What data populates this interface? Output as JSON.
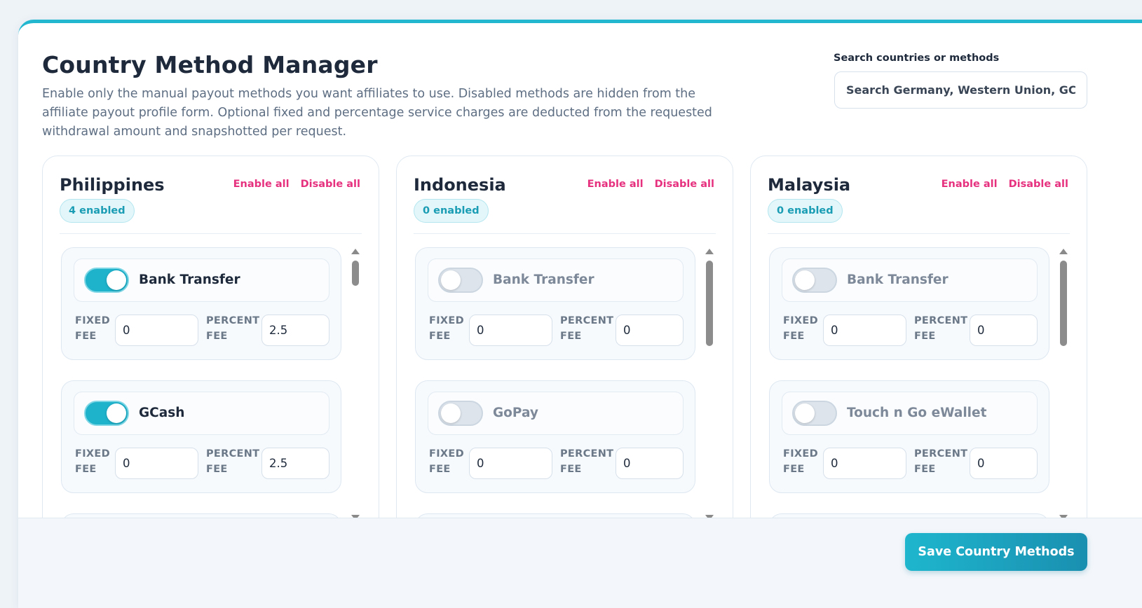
{
  "header": {
    "title": "Country Method Manager",
    "description": "Enable only the manual payout methods you want affiliates to use. Disabled methods are hidden from the affiliate payout profile form. Optional fixed and percentage service charges are deducted from the requested withdrawal amount and snapshotted per request."
  },
  "search": {
    "label": "Search countries or methods",
    "placeholder": "Search Germany, Western Union, GCash..."
  },
  "labels": {
    "enable_all": "Enable all",
    "disable_all": "Disable all",
    "fixed_fee": "FIXED\nFEE",
    "percent_fee": "PERCENT\nFEE"
  },
  "countries": [
    {
      "name": "Philippines",
      "badge": "4 enabled",
      "scroll_thumb_fraction": 0.1,
      "methods": [
        {
          "name": "Bank Transfer",
          "enabled": true,
          "fixed_fee": "0",
          "percent_fee": "2.5"
        },
        {
          "name": "GCash",
          "enabled": true,
          "fixed_fee": "0",
          "percent_fee": "2.5"
        }
      ]
    },
    {
      "name": "Indonesia",
      "badge": "0 enabled",
      "scroll_thumb_fraction": 0.34,
      "methods": [
        {
          "name": "Bank Transfer",
          "enabled": false,
          "fixed_fee": "0",
          "percent_fee": "0"
        },
        {
          "name": "GoPay",
          "enabled": false,
          "fixed_fee": "0",
          "percent_fee": "0"
        }
      ]
    },
    {
      "name": "Malaysia",
      "badge": "0 enabled",
      "scroll_thumb_fraction": 0.34,
      "methods": [
        {
          "name": "Bank Transfer",
          "enabled": false,
          "fixed_fee": "0",
          "percent_fee": "0"
        },
        {
          "name": "Touch n Go eWallet",
          "enabled": false,
          "fixed_fee": "0",
          "percent_fee": "0"
        }
      ]
    }
  ],
  "footer": {
    "save_label": "Save Country Methods"
  },
  "colors": {
    "accent": "#22b7cf",
    "link": "#e6317f",
    "title": "#1e2a3b"
  }
}
